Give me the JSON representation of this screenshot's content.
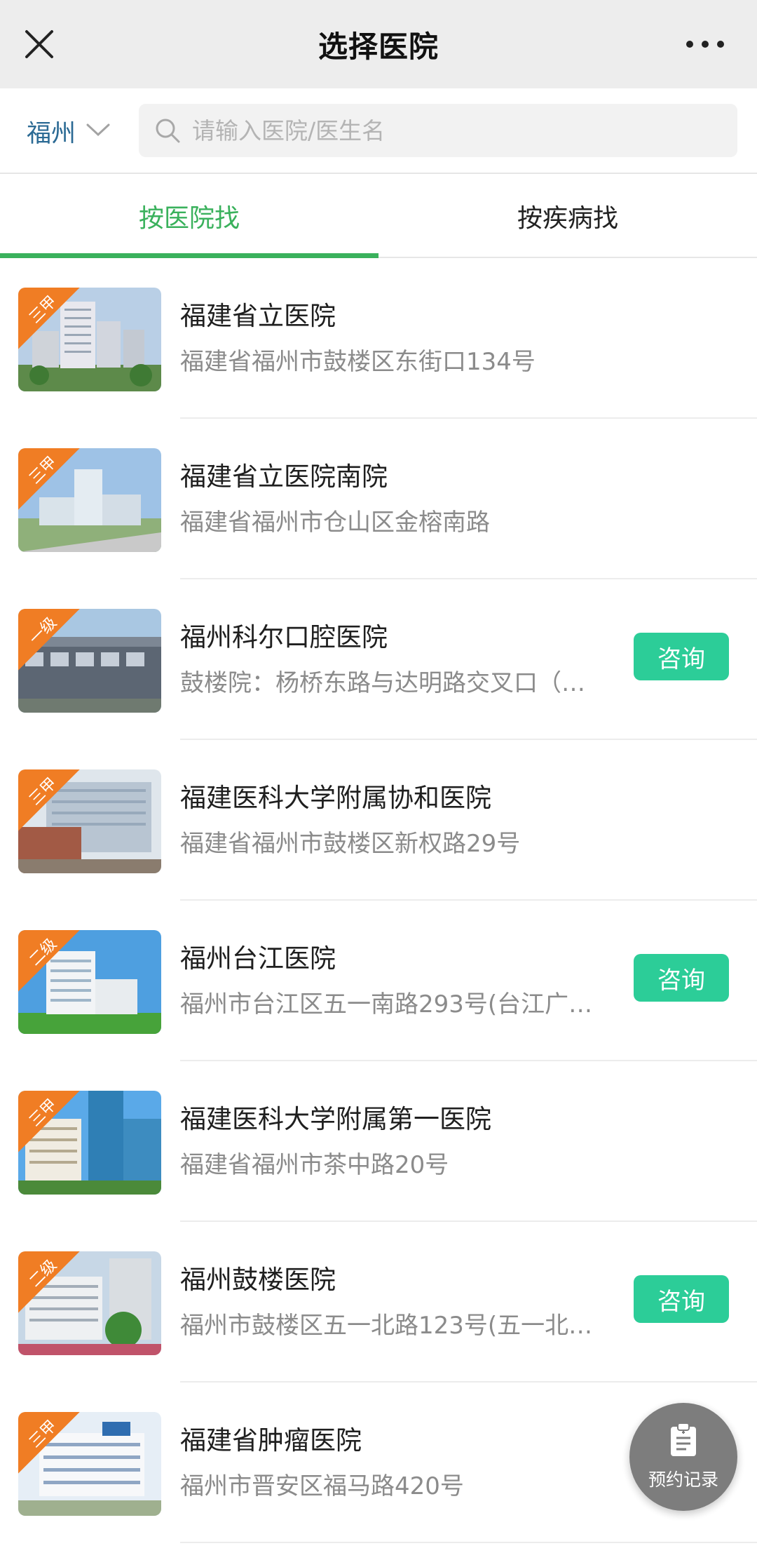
{
  "header": {
    "title": "选择医院"
  },
  "search": {
    "city": "福州",
    "placeholder": "请输入医院/医生名"
  },
  "tabs": [
    {
      "label": "按医院找",
      "active": true
    },
    {
      "label": "按疾病找",
      "active": false
    }
  ],
  "hospitals": [
    {
      "name": "福建省立医院",
      "address": "福建省福州市鼓楼区东街口134号",
      "level": "三甲",
      "consult": null
    },
    {
      "name": "福建省立医院南院",
      "address": "福建省福州市仓山区金榕南路",
      "level": "三甲",
      "consult": null
    },
    {
      "name": "福州科尔口腔医院",
      "address": "鼓楼院：杨桥东路与达明路交叉口（…",
      "level": "一级",
      "consult": "咨询"
    },
    {
      "name": "福建医科大学附属协和医院",
      "address": "福建省福州市鼓楼区新权路29号",
      "level": "三甲",
      "consult": null
    },
    {
      "name": "福州台江医院",
      "address": "福州市台江区五一南路293号(台江广…",
      "level": "二级",
      "consult": "咨询"
    },
    {
      "name": "福建医科大学附属第一医院",
      "address": "福建省福州市茶中路20号",
      "level": "三甲",
      "consult": null
    },
    {
      "name": "福州鼓楼医院",
      "address": "福州市鼓楼区五一北路123号(五一北…",
      "level": "二级",
      "consult": "咨询"
    },
    {
      "name": "福建省肿瘤医院",
      "address": "福州市晋安区福马路420号",
      "level": "三甲",
      "consult": null
    }
  ],
  "fab": {
    "label": "预约记录",
    "icon": "clipboard-icon"
  },
  "colors": {
    "accent": "#3ab15c",
    "consult": "#2ccd98",
    "badge": "#f07d24",
    "city": "#2b6a94"
  }
}
